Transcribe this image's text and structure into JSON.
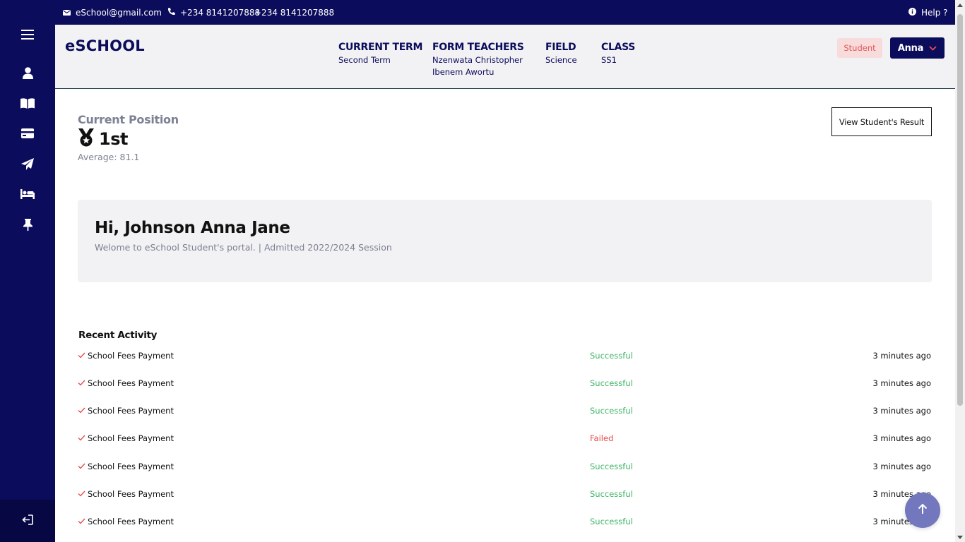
{
  "topbar": {
    "email": "eSchool@gmail.com",
    "phone_1": "+234 8141207888",
    "phone_2": "+234 8141207888",
    "help": "Help ?"
  },
  "sidebar": {
    "items": [
      {
        "icon": "menu-icon"
      },
      {
        "icon": "user-icon"
      },
      {
        "icon": "book-icon"
      },
      {
        "icon": "credit-card-icon"
      },
      {
        "icon": "paper-plane-icon"
      },
      {
        "icon": "bed-icon"
      },
      {
        "icon": "pin-icon"
      }
    ],
    "logout_icon": "logout-icon"
  },
  "header": {
    "brand": "eSCHOOL",
    "current_term": {
      "title": "CURRENT TERM",
      "value": "Second Term"
    },
    "form_teachers": {
      "title": "FORM TEACHERS",
      "values": [
        "Nzenwata Christopher",
        "Ibenem Awortu"
      ]
    },
    "field": {
      "title": "FIELD",
      "value": "Science"
    },
    "class": {
      "title": "CLASS",
      "value": "SS1"
    },
    "role_badge": "Student",
    "user_name": "Anna"
  },
  "position": {
    "label": "Current Position",
    "value": "1st",
    "average_label": "Average:",
    "average_value": "81.1"
  },
  "view_result_button": "View Student's Result",
  "welcome": {
    "title": "Hi, Johnson Anna Jane",
    "subtitle": "Welome to eSchool Student's portal. | Admitted 2022/2024 Session"
  },
  "recent_activity": {
    "title": "Recent Activity",
    "items": [
      {
        "label": "School Fees Payment",
        "status": "Successful",
        "time": "3 minutes ago"
      },
      {
        "label": "School Fees Payment",
        "status": "Successful",
        "time": "3 minutes ago"
      },
      {
        "label": "School Fees Payment",
        "status": "Successful",
        "time": "3 minutes ago"
      },
      {
        "label": "School Fees Payment",
        "status": "Failed",
        "time": "3 minutes ago"
      },
      {
        "label": "School Fees Payment",
        "status": "Successful",
        "time": "3 minutes ago"
      },
      {
        "label": "School Fees Payment",
        "status": "Successful",
        "time": "3 minutes ago"
      },
      {
        "label": "School Fees Payment",
        "status": "Successful",
        "time": "3 minutes ago"
      }
    ]
  },
  "colors": {
    "navy": "#0c0c5c",
    "success": "#3fb567",
    "failed": "#ea4d4d",
    "badge_bg": "#f8dcdc",
    "fab": "#7377bd"
  }
}
